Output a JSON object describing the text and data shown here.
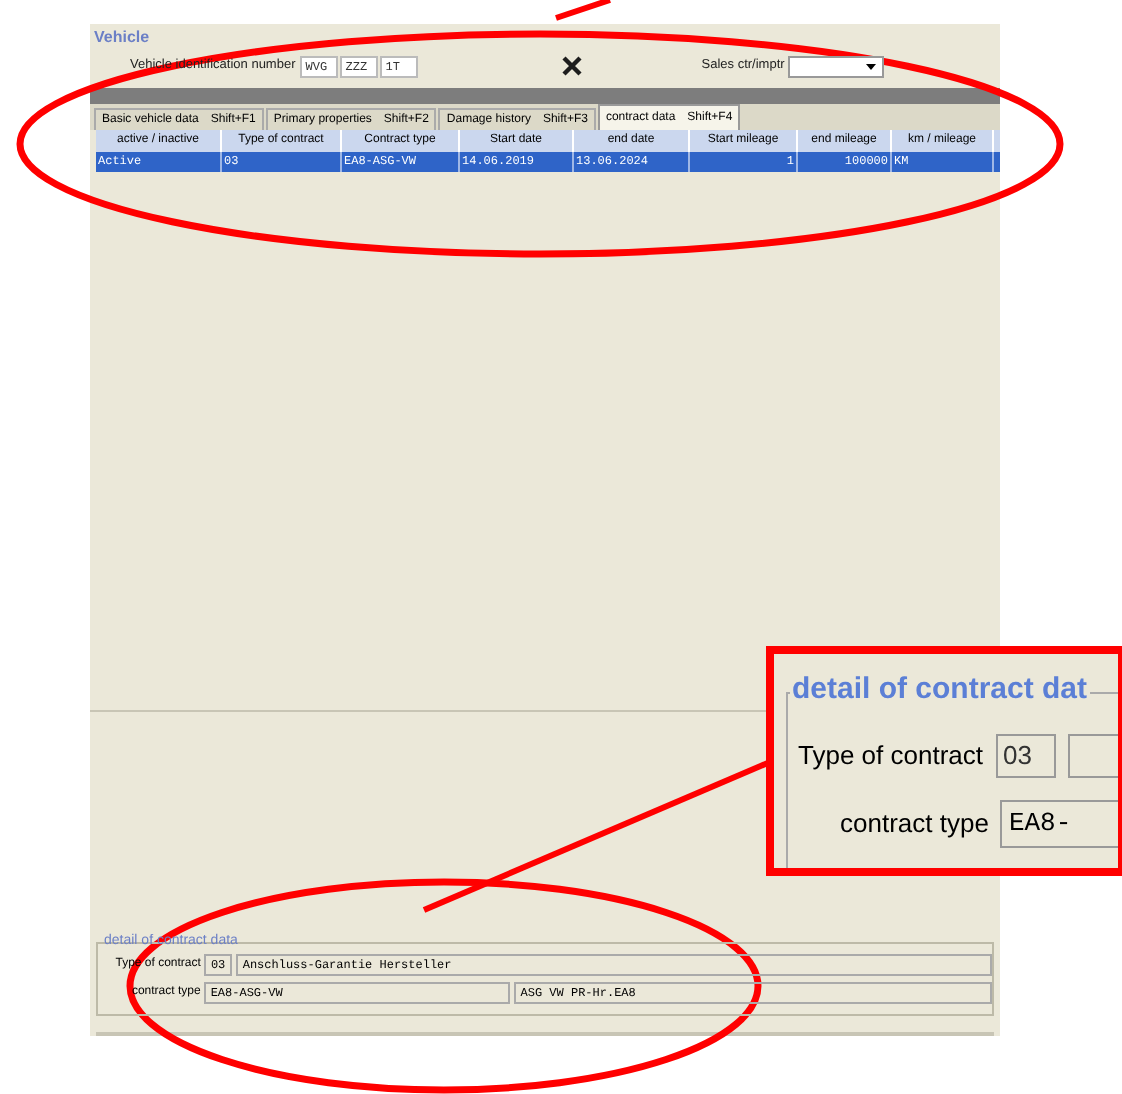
{
  "section_title": "Vehicle",
  "vin": {
    "label": "Vehicle identification number",
    "parts": [
      "WVG",
      "ZZZ",
      "1T"
    ]
  },
  "sales": {
    "label": "Sales ctr/imptr"
  },
  "tabs": [
    {
      "label": "Basic vehicle data",
      "shortcut": "Shift+F1",
      "selected": false
    },
    {
      "label": "Primary properties",
      "shortcut": "Shift+F2",
      "selected": false
    },
    {
      "label": "Damage history",
      "shortcut": "Shift+F3",
      "selected": false
    },
    {
      "label": "contract data",
      "shortcut": "Shift+F4",
      "selected": true
    }
  ],
  "table": {
    "columns": [
      "active / inactive",
      "Type of contract",
      "Contract type",
      "Start date",
      "end date",
      "Start mileage",
      "end mileage",
      "km / mileage"
    ],
    "rows": [
      {
        "selected": true,
        "cells": [
          "Active",
          "03",
          "EA8-ASG-VW",
          "14.06.2019",
          "13.06.2024",
          "1",
          "100000",
          "KM"
        ]
      }
    ]
  },
  "detail": {
    "title": "detail of contract data",
    "type_label": "Type of contract",
    "type_code": "03",
    "type_text": "Anschluss-Garantie Hersteller",
    "contract_label": "contract type",
    "contract_code": "EA8-ASG-VW",
    "contract_text": "ASG VW PR-Hr.EA8"
  },
  "callout": {
    "title": "detail of contract dat",
    "type_label": "Type of contract",
    "type_code": "03",
    "contract_label": "contract type",
    "contract_code": "EA8-"
  }
}
